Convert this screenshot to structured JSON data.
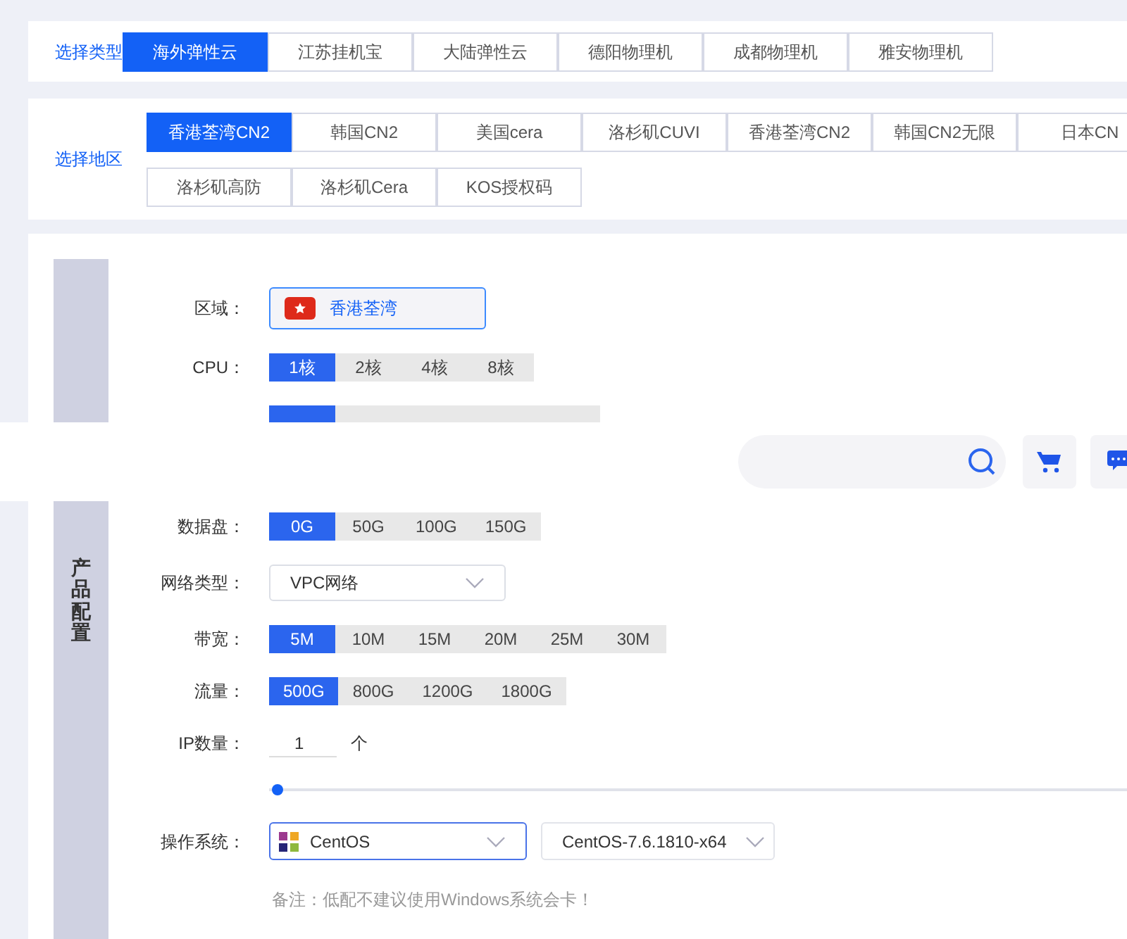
{
  "type_selector": {
    "label": "选择类型",
    "options": [
      {
        "label": "海外弹性云",
        "selected": true
      },
      {
        "label": "江苏挂机宝",
        "selected": false
      },
      {
        "label": "大陆弹性云",
        "selected": false
      },
      {
        "label": "德阳物理机",
        "selected": false
      },
      {
        "label": "成都物理机",
        "selected": false
      },
      {
        "label": "雅安物理机",
        "selected": false
      }
    ]
  },
  "region_selector": {
    "label": "选择地区",
    "options": [
      {
        "label": "香港荃湾CN2",
        "selected": true
      },
      {
        "label": "韩国CN2",
        "selected": false
      },
      {
        "label": "美国cera",
        "selected": false
      },
      {
        "label": "洛杉矶CUVI",
        "selected": false
      },
      {
        "label": "香港荃湾CN2",
        "selected": false
      },
      {
        "label": "韩国CN2无限",
        "selected": false
      },
      {
        "label": "日本CN",
        "selected": false
      },
      {
        "label": "洛杉矶高防",
        "selected": false
      },
      {
        "label": "洛杉矶Cera",
        "selected": false
      },
      {
        "label": "KOS授权码",
        "selected": false
      }
    ]
  },
  "config": {
    "section_title": "产品配置",
    "fields": [
      {
        "kind": "region",
        "label": "区域：",
        "value": "香港荃湾"
      },
      {
        "kind": "segmented",
        "label": "CPU：",
        "options": [
          {
            "label": "1核",
            "selected": true
          },
          {
            "label": "2核",
            "selected": false
          },
          {
            "label": "4核",
            "selected": false
          },
          {
            "label": "8核",
            "selected": false
          }
        ]
      },
      {
        "kind": "cut_segmented",
        "options": [
          {
            "selected": true
          },
          {
            "selected": false
          },
          {
            "selected": false
          },
          {
            "selected": false
          },
          {
            "selected": false
          }
        ]
      },
      {
        "kind": "segmented",
        "label": "数据盘：",
        "options": [
          {
            "label": "0G",
            "selected": true
          },
          {
            "label": "50G",
            "selected": false
          },
          {
            "label": "100G",
            "selected": false
          },
          {
            "label": "150G",
            "selected": false
          }
        ]
      },
      {
        "kind": "select",
        "label": "网络类型：",
        "value": "VPC网络"
      },
      {
        "kind": "segmented",
        "label": "带宽：",
        "options": [
          {
            "label": "5M",
            "selected": true
          },
          {
            "label": "10M",
            "selected": false
          },
          {
            "label": "15M",
            "selected": false
          },
          {
            "label": "20M",
            "selected": false
          },
          {
            "label": "25M",
            "selected": false
          },
          {
            "label": "30M",
            "selected": false
          }
        ]
      },
      {
        "kind": "segmented",
        "label": "流量：",
        "options": [
          {
            "label": "500G",
            "selected": true
          },
          {
            "label": "800G",
            "selected": false
          },
          {
            "label": "1200G",
            "selected": false
          },
          {
            "label": "1800G",
            "selected": false
          }
        ]
      },
      {
        "kind": "quantity",
        "label": "IP数量：",
        "value": "1",
        "unit": "个"
      },
      {
        "kind": "slider",
        "level": 0
      },
      {
        "kind": "os",
        "label": "操作系统：",
        "os": "CentOS",
        "version": "CentOS-7.6.1810-x64"
      }
    ],
    "note": "备注：低配不建议使用Windows系统会卡！"
  }
}
